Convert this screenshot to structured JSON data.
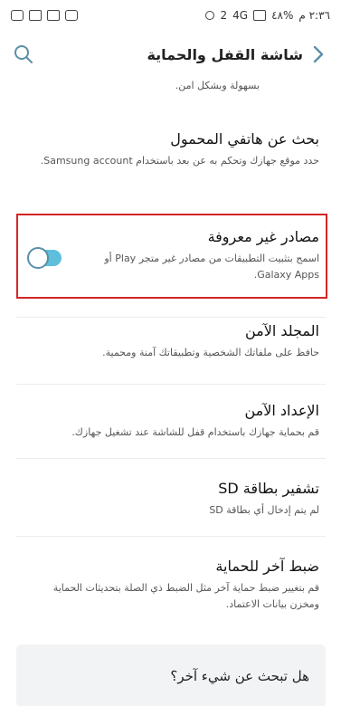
{
  "status_bar": {
    "time": "٢:٣٦ م",
    "battery": "٤٨%",
    "network": "4G",
    "notification_count": "2"
  },
  "header": {
    "title": "شاشة القفل والحماية"
  },
  "partial_text": "بسهولة وبشكل امن.",
  "items": [
    {
      "title": "بحث عن هاتفي المحمول",
      "subtitle": "حدد موقع جهازك وتحكم به عن بعد باستخدام Samsung account."
    },
    {
      "title": "مصادر غير معروفة",
      "subtitle": "اسمح بتثبيت التطبيقات من مصادر غير متجر Play أو Galaxy Apps.",
      "toggle_on": true
    },
    {
      "title": "المجلد الآمن",
      "subtitle": "حافظ على ملفاتك الشخصية وتطبيقاتك آمنة ومحمية."
    },
    {
      "title": "الإعداد الآمن",
      "subtitle": "قم بحماية جهازك باستخدام قفل للشاشة عند تشغيل جهازك."
    },
    {
      "title": "تشفير بطاقة SD",
      "subtitle": "لم يتم إدخال أي بطاقة SD"
    },
    {
      "title": "ضبط آخر للحماية",
      "subtitle": "قم بتغيير ضبط حماية آخر مثل الضبط ذي الصلة بتحديثات الحماية ومخزن بيانات الاعتماد."
    }
  ],
  "footer": {
    "title": "هل تبحث عن شيء آخر؟"
  },
  "colors": {
    "accent": "#5dbfdc",
    "highlight": "#d32626"
  }
}
